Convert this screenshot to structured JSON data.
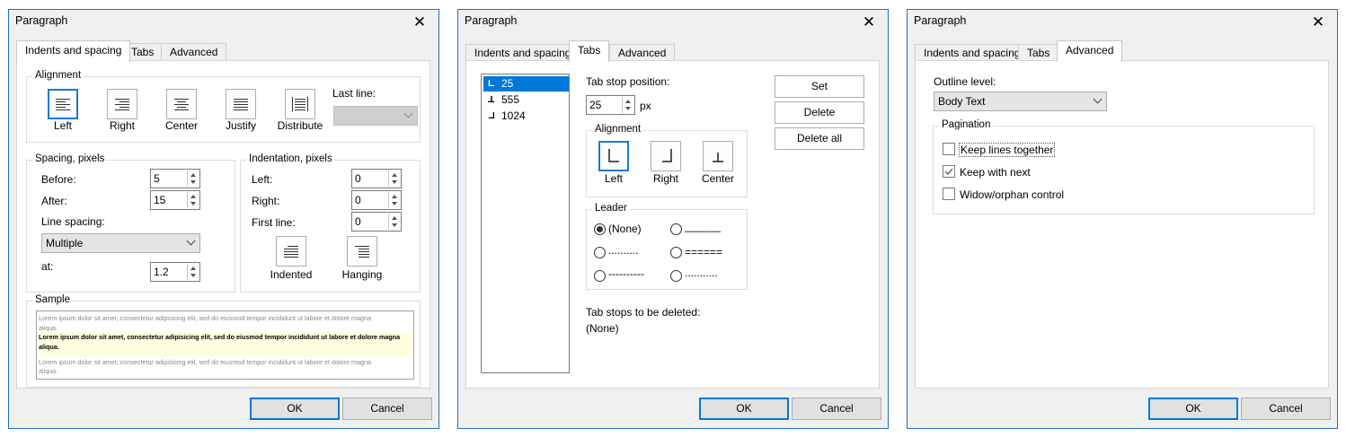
{
  "title": "Paragraph",
  "close_glyph": "✕",
  "tabs": [
    "Indents and spacing",
    "Tabs",
    "Advanced"
  ],
  "buttons": {
    "ok": "OK",
    "cancel": "Cancel"
  },
  "indents": {
    "alignment_group": "Alignment",
    "alignments": [
      "Left",
      "Right",
      "Center",
      "Justify",
      "Distribute"
    ],
    "selected_alignment": "Left",
    "last_line_label": "Last line:",
    "last_line_value": "",
    "spacing_group": "Spacing, pixels",
    "before_label": "Before:",
    "before_value": "5",
    "after_label": "After:",
    "after_value": "15",
    "line_spacing_label": "Line spacing:",
    "line_spacing_value": "Multiple",
    "at_label": "at:",
    "at_value": "1.2",
    "indentation_group": "Indentation, pixels",
    "left_label": "Left:",
    "left_value": "0",
    "right_label": "Right:",
    "right_value": "0",
    "first_line_label": "First line:",
    "first_line_value": "0",
    "indented_label": "Indented",
    "hanging_label": "Hanging",
    "sample_group": "Sample",
    "sample_lines": [
      "Lorem ipsum dolor sit amet, consectetur adipisicing elit, sed do eiusmod tempor incididunt ut labore et dolore magna",
      "aliqua.",
      "Lorem ipsum dolor sit amet, consectetur adipisicing elit, sed do eiusmod tempor incididunt ut labore et dolore magna",
      "aliqua.",
      "Lorem ipsum dolor sit amet, consectetur adipisicing elit, sed do eiusmod tempor incididunt ut labore et dolore magna",
      "aliqua."
    ]
  },
  "tabs_page": {
    "tab_stops": [
      "25",
      "555",
      "1024"
    ],
    "selected_stop": "25",
    "position_label": "Tab stop position:",
    "position_value": "25",
    "unit": "px",
    "set_label": "Set",
    "delete_label": "Delete",
    "delete_all_label": "Delete all",
    "alignment_group": "Alignment",
    "alignments": [
      "Left",
      "Right",
      "Center"
    ],
    "leader_group": "Leader",
    "leaders": [
      "(None)",
      "______",
      "..........",
      "======",
      "----------",
      "..........."
    ],
    "selected_leader": "(None)",
    "to_delete_label": "Tab stops to be deleted:",
    "to_delete_value": "(None)"
  },
  "advanced": {
    "outline_label": "Outline level:",
    "outline_value": "Body Text",
    "pagination_group": "Pagination",
    "keep_lines": "Keep lines together",
    "keep_lines_checked": false,
    "keep_next": "Keep with next",
    "keep_next_checked": true,
    "widow": "Widow/orphan control",
    "widow_checked": false
  },
  "colors": {
    "accent": "#1c6fc4",
    "selection": "#0078d7",
    "sample_highlight": "#ffffe0"
  }
}
